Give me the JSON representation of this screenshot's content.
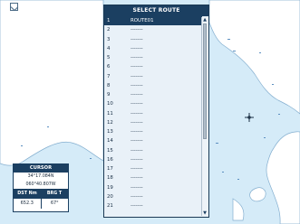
{
  "route_panel": {
    "title": "SELECT ROUTE",
    "routes": [
      {
        "number": "1",
        "name": "ROUTE01"
      },
      {
        "number": "2",
        "name": "-------"
      },
      {
        "number": "3",
        "name": "-------"
      },
      {
        "number": "4",
        "name": "-------"
      },
      {
        "number": "5",
        "name": "-------"
      },
      {
        "number": "6",
        "name": "-------"
      },
      {
        "number": "7",
        "name": "-------"
      },
      {
        "number": "8",
        "name": "-------"
      },
      {
        "number": "9",
        "name": "-------"
      },
      {
        "number": "10",
        "name": "-------"
      },
      {
        "number": "11",
        "name": "-------"
      },
      {
        "number": "12",
        "name": "-------"
      },
      {
        "number": "13",
        "name": "-------"
      },
      {
        "number": "14",
        "name": "-------"
      },
      {
        "number": "15",
        "name": "-------"
      },
      {
        "number": "16",
        "name": "-------"
      },
      {
        "number": "17",
        "name": "-------"
      },
      {
        "number": "18",
        "name": "-------"
      },
      {
        "number": "19",
        "name": "-------"
      },
      {
        "number": "20",
        "name": "-------"
      },
      {
        "number": "21",
        "name": "-------"
      }
    ]
  },
  "cursor_panel": {
    "title": "CURSOR",
    "latitude": "34°17.084N",
    "longitude": "060°40.807W",
    "dst_label": "DST Nm",
    "brg_label": "BRG T",
    "dst_value": "652.3",
    "brg_value": "67°"
  },
  "icons": {
    "top_left": "north-up-icon",
    "map_center": "cursor-crosshair-icon"
  },
  "colors": {
    "panel_header": "#1b3f61",
    "map_water": "#d5ebf8",
    "land": "#ffffff",
    "selected_row": "#1b3f61"
  }
}
